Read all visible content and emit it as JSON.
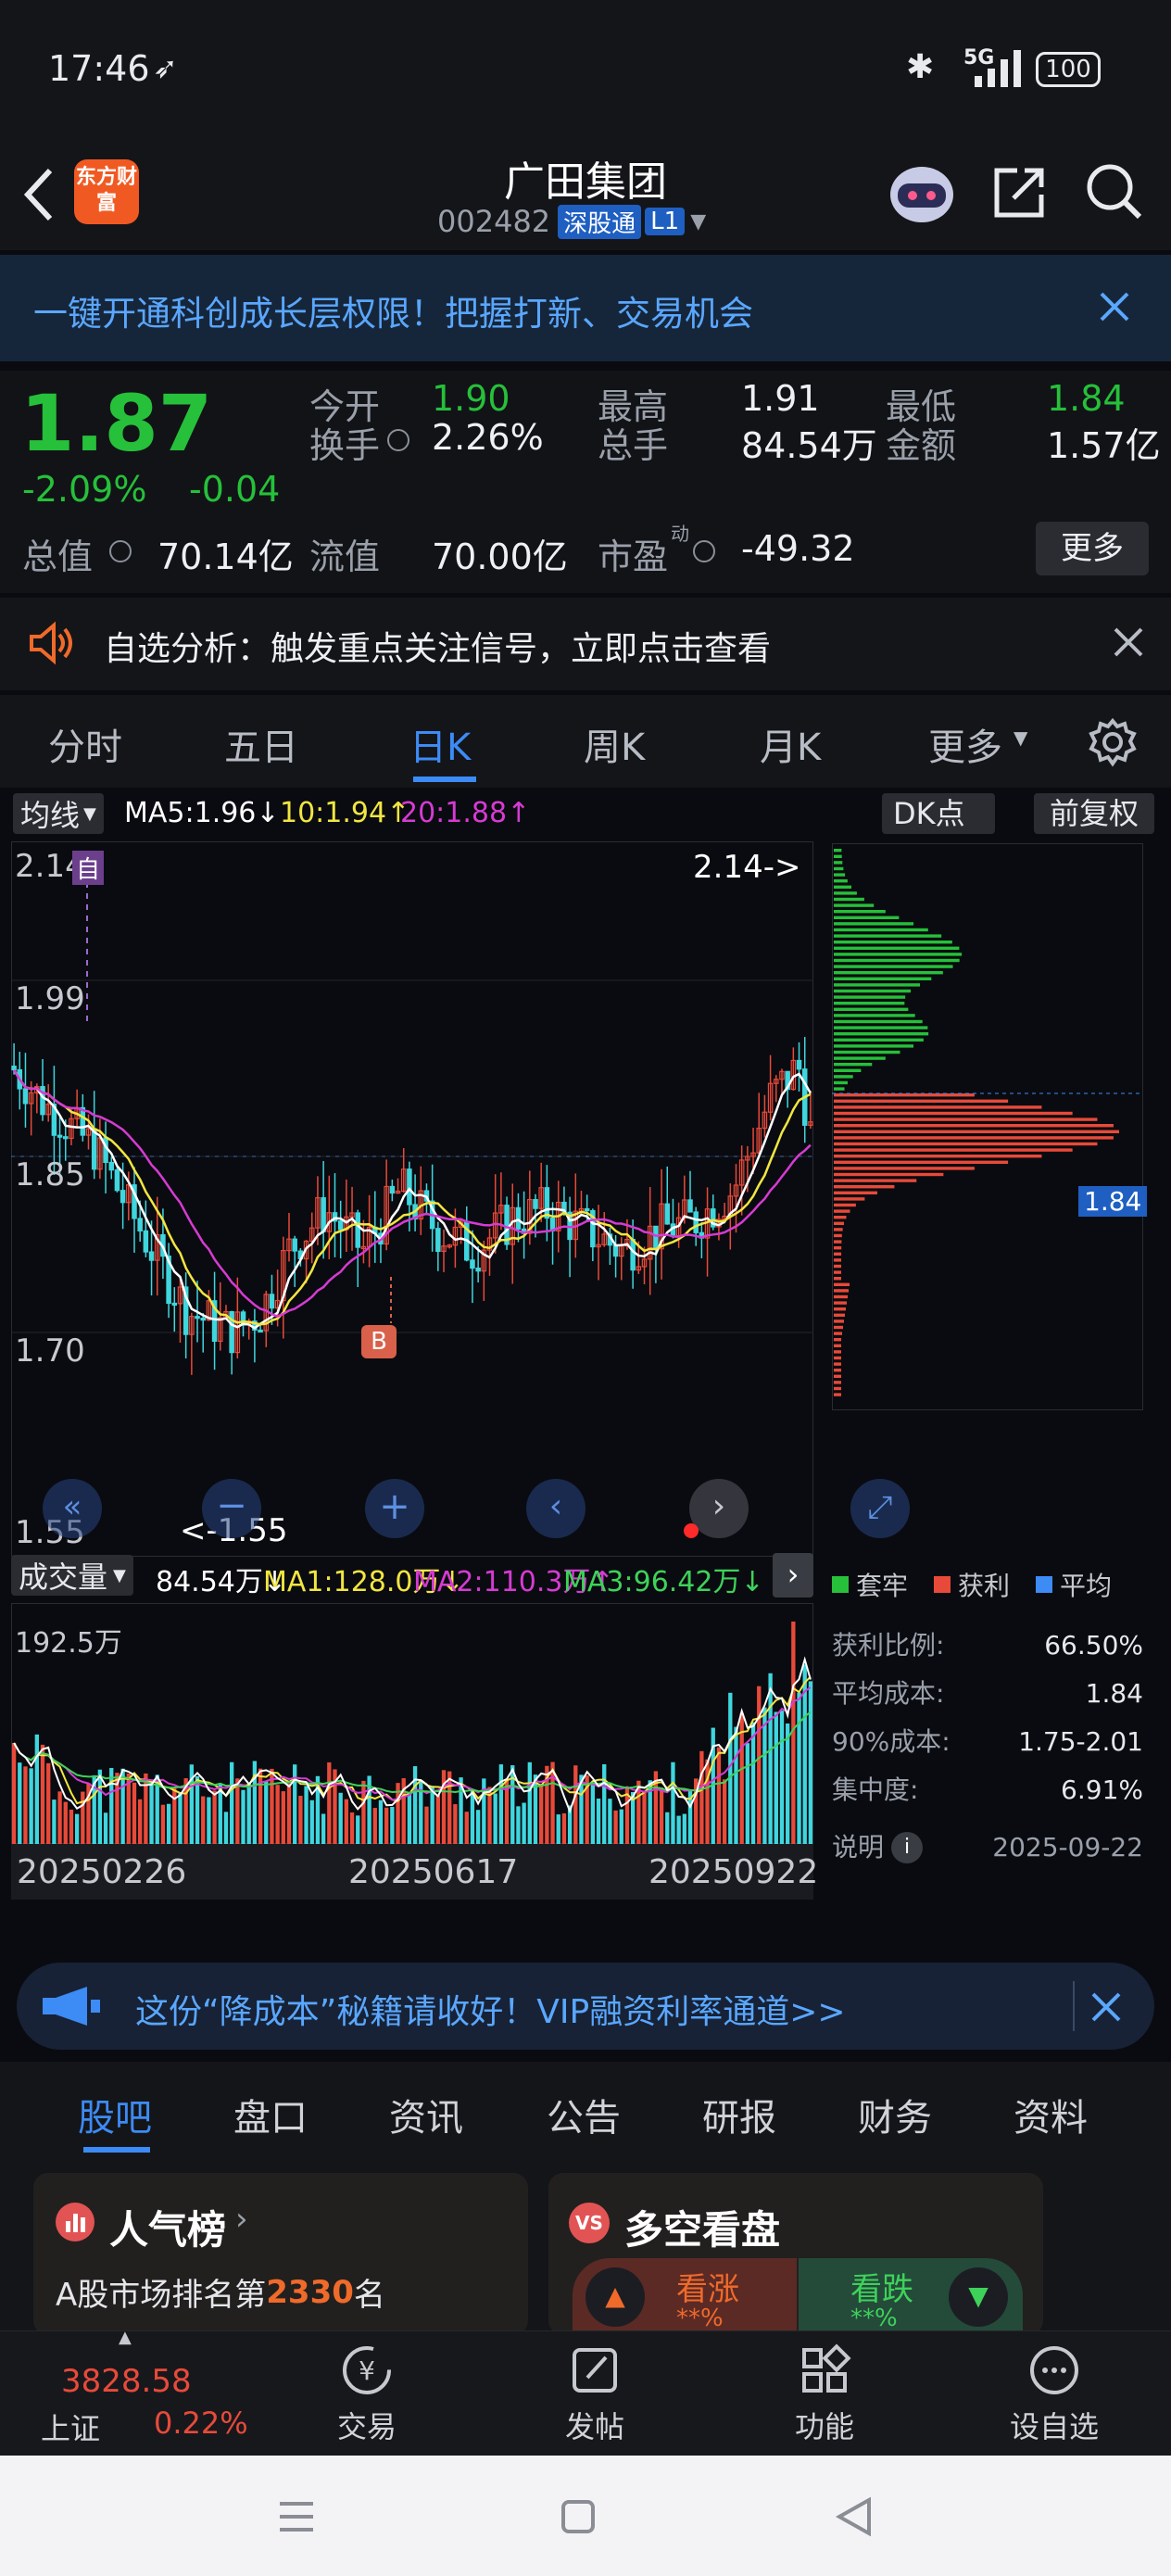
{
  "status": {
    "time": "17:46",
    "network": "5G",
    "battery": "100"
  },
  "header": {
    "title": "广田集团",
    "code": "002482",
    "exchange_badge": "深股通",
    "level_badge": "L1",
    "logo_text": "东方财富"
  },
  "banner": {
    "text": "一键开通科创成长层权限！把握打新、交易机会"
  },
  "quote": {
    "price": "1.87",
    "change_pct": "-2.09%",
    "change": "-0.04",
    "items": [
      {
        "label": "今开",
        "value": "1.90",
        "color": "green"
      },
      {
        "label": "最高",
        "value": "1.91",
        "color": "white"
      },
      {
        "label": "最低",
        "value": "1.84",
        "color": "green"
      },
      {
        "label": "换手",
        "value": "2.26%",
        "color": "white"
      },
      {
        "label": "总手",
        "value": "84.54万",
        "color": "white"
      },
      {
        "label": "金额",
        "value": "1.57亿",
        "color": "white"
      },
      {
        "label": "总值",
        "value": "70.14亿",
        "color": "white"
      },
      {
        "label": "流值",
        "value": "70.00亿",
        "color": "white"
      },
      {
        "label": "市盈",
        "value": "-49.32",
        "color": "white"
      }
    ],
    "pe_sup": "动",
    "more_label": "更多"
  },
  "notice": {
    "text": "自选分析：触发重点关注信号，立即点击查看"
  },
  "chart_tabs": [
    "分时",
    "五日",
    "日K",
    "周K",
    "月K",
    "更多"
  ],
  "active_tab": "日K",
  "kline": {
    "indicator_select": "均线",
    "ma5": "MA5:1.96↓",
    "ma10": "10:1.94↑",
    "ma20": "20:1.88↑",
    "dk_label": "DK点",
    "adjust_label": "前复权",
    "price_labels": [
      "2.14",
      "1.99",
      "1.85",
      "1.70",
      "1.55"
    ],
    "self_tag": "自",
    "high_note": "2.14->",
    "low_note": "<-1.55",
    "b_marker": "B",
    "current_price_tag": "1.84"
  },
  "volume": {
    "select": "成交量",
    "vol": "84.54万↓",
    "ma1": "MA1:128.0万↓",
    "ma2": "MA2:110.3万↑",
    "ma3": "MA3:96.42万↓",
    "max_label": "192.5万",
    "dates": [
      "20250226",
      "20250617",
      "20250922"
    ]
  },
  "chip": {
    "legend": [
      "套牢",
      "获利",
      "平均"
    ],
    "stats": [
      {
        "label": "获利比例:",
        "value": "66.50%"
      },
      {
        "label": "平均成本:",
        "value": "1.84"
      },
      {
        "label": "90%成本:",
        "value": "1.75-2.01"
      },
      {
        "label": "集中度:",
        "value": "6.91%"
      }
    ],
    "note_label": "说明",
    "date": "2025-09-22"
  },
  "promo": {
    "text": "这份“降成本”秘籍请收好！VIP融资利率通道>>"
  },
  "bottom_tabs": [
    "股吧",
    "盘口",
    "资讯",
    "公告",
    "研报",
    "财务",
    "资料"
  ],
  "cards": {
    "popularity_title": "人气榜",
    "rank_prefix": "A股市场排名第",
    "rank": "2330",
    "rank_suffix": "名",
    "vote_title": "多空看盘",
    "bull_label": "看涨",
    "bear_label": "看跌",
    "bull_pct": "**%",
    "bear_pct": "**%"
  },
  "dock": {
    "index_value": "3828.58",
    "index_name": "上证",
    "index_change": "0.22%",
    "items": [
      "交易",
      "发帖",
      "功能",
      "设自选"
    ]
  },
  "colors": {
    "up": "#e84a3a",
    "down": "#26c03a",
    "accent": "#3d8bf5",
    "ma5": "#ffffff",
    "ma10": "#f2e640",
    "ma20": "#d63bd3",
    "candle_down": "#3fd6de"
  }
}
